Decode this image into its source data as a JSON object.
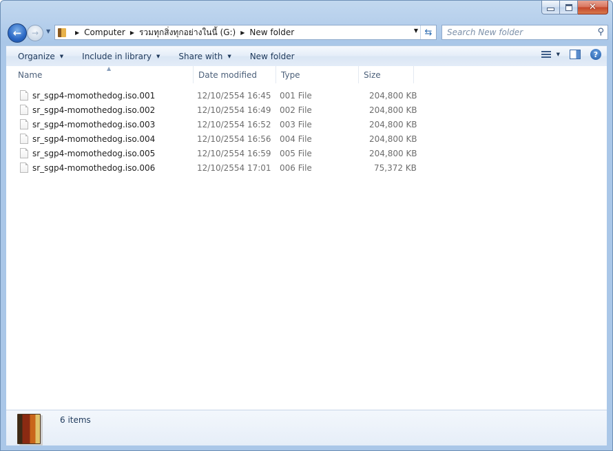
{
  "address": {
    "segments": [
      "Computer",
      "รวมทุกสิ่งทุกอย่างในนี้ (G:)",
      "New folder"
    ]
  },
  "search": {
    "placeholder": "Search New folder"
  },
  "toolbar": {
    "organize": "Organize",
    "include_in_library": "Include in library",
    "share_with": "Share with",
    "new_folder": "New folder"
  },
  "columns": {
    "name": "Name",
    "date_modified": "Date modified",
    "type": "Type",
    "size": "Size"
  },
  "files": [
    {
      "name": "sr_sgp4-momothedog.iso.001",
      "date": "12/10/2554 16:45",
      "type": "001 File",
      "size": "204,800 KB"
    },
    {
      "name": "sr_sgp4-momothedog.iso.002",
      "date": "12/10/2554 16:49",
      "type": "002 File",
      "size": "204,800 KB"
    },
    {
      "name": "sr_sgp4-momothedog.iso.003",
      "date": "12/10/2554 16:52",
      "type": "003 File",
      "size": "204,800 KB"
    },
    {
      "name": "sr_sgp4-momothedog.iso.004",
      "date": "12/10/2554 16:56",
      "type": "004 File",
      "size": "204,800 KB"
    },
    {
      "name": "sr_sgp4-momothedog.iso.005",
      "date": "12/10/2554 16:59",
      "type": "005 File",
      "size": "204,800 KB"
    },
    {
      "name": "sr_sgp4-momothedog.iso.006",
      "date": "12/10/2554 17:01",
      "type": "006 File",
      "size": "75,372 KB"
    }
  ],
  "details": {
    "item_count": "6 items"
  }
}
